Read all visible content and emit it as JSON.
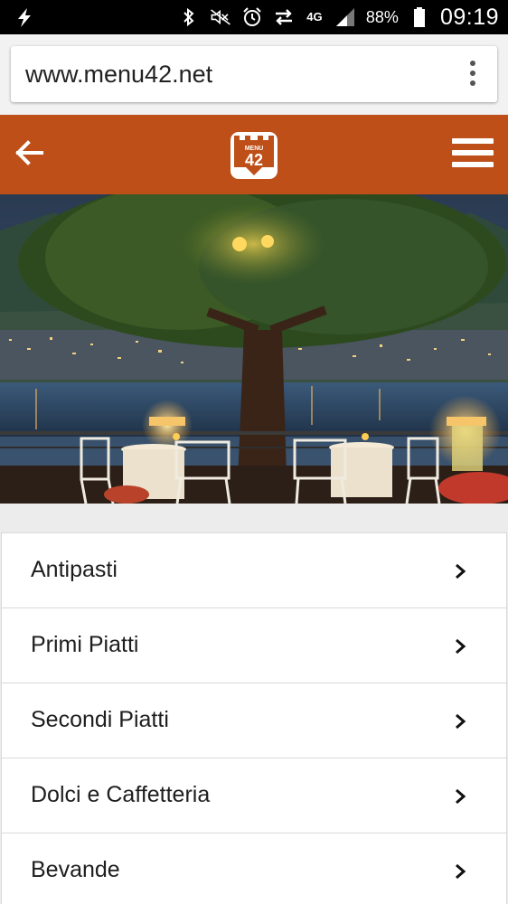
{
  "status_bar": {
    "battery_percent": "88%",
    "time": "09:19",
    "network_type": "4G",
    "icons": [
      "lightning-icon",
      "bluetooth-icon",
      "mute-icon",
      "alarm-icon",
      "data-sync-icon",
      "network-4g-icon",
      "signal-icon",
      "battery-icon"
    ]
  },
  "browser": {
    "url": "www.menu42.net"
  },
  "header": {
    "logo_text_top": "MENU",
    "logo_text_main": "42",
    "brand_color": "#be4f19",
    "icons": [
      "back-arrow-icon",
      "menu42-logo",
      "hamburger-icon"
    ]
  },
  "menu": {
    "items": [
      {
        "label": "Antipasti"
      },
      {
        "label": "Primi Piatti"
      },
      {
        "label": "Secondi Piatti"
      },
      {
        "label": "Dolci e Caffetteria"
      },
      {
        "label": "Bevande"
      }
    ]
  }
}
